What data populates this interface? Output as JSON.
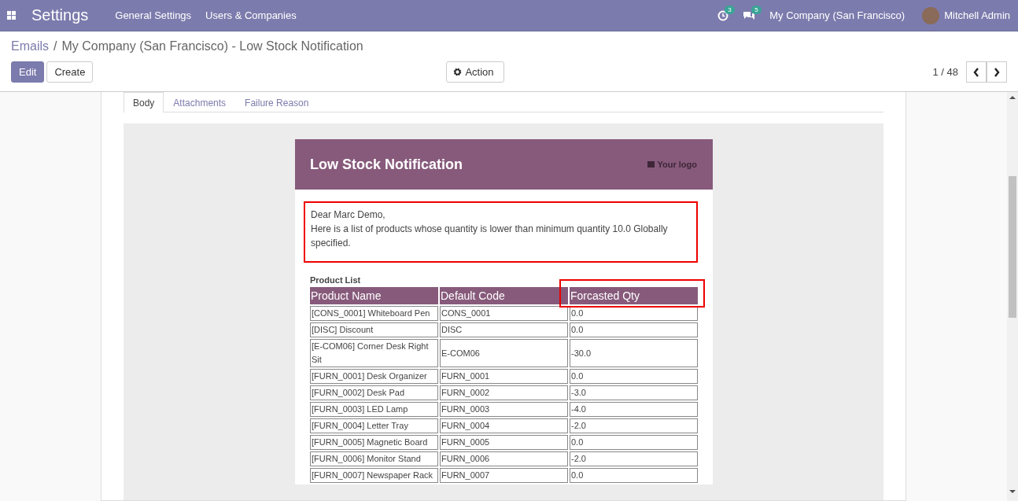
{
  "navbar": {
    "app_title": "Settings",
    "menu": [
      "General Settings",
      "Users & Companies"
    ],
    "activity_count": "3",
    "message_count": "5",
    "company": "My Company (San Francisco)",
    "user": "Mitchell Admin"
  },
  "breadcrumb": {
    "parent": "Emails",
    "separator": "/",
    "current": "My Company (San Francisco) - Low Stock Notification"
  },
  "buttons": [
    {
      "label": "Edit",
      "kind": "primary"
    },
    {
      "label": "Create",
      "kind": "secondary"
    }
  ],
  "action_button": "Action",
  "pager": {
    "value": "1 / 48"
  },
  "tabs": [
    {
      "label": "Body",
      "selected": true
    },
    {
      "label": "Attachments",
      "selected": false
    },
    {
      "label": "Failure Reason",
      "selected": false
    }
  ],
  "email": {
    "title": "Low Stock Notification",
    "logo_text": "Your logo",
    "greeting": "Dear Marc Demo,",
    "message": "Here is a list of products whose quantity is lower than minimum quantity 10.0 Globally specified.",
    "greeting_highlighted": true,
    "table": {
      "caption": "Product List",
      "columns": [
        {
          "label": "Product Name",
          "highlighted": false
        },
        {
          "label": "Default Code",
          "highlighted": false
        },
        {
          "label": "Forcasted Qty",
          "highlighted": true
        }
      ],
      "rows": [
        [
          "[CONS_0001] Whiteboard Pen",
          "CONS_0001",
          "0.0"
        ],
        [
          "[DISC] Discount",
          "DISC",
          "0.0"
        ],
        [
          "[E-COM06] Corner Desk Right Sit",
          "E-COM06",
          "-30.0"
        ],
        [
          "[FURN_0001] Desk Organizer",
          "FURN_0001",
          "0.0"
        ],
        [
          "[FURN_0002] Desk Pad",
          "FURN_0002",
          "-3.0"
        ],
        [
          "[FURN_0003] LED Lamp",
          "FURN_0003",
          "-4.0"
        ],
        [
          "[FURN_0004] Letter Tray",
          "FURN_0004",
          "-2.0"
        ],
        [
          "[FURN_0005] Magnetic Board",
          "FURN_0005",
          "0.0"
        ],
        [
          "[FURN_0006] Monitor Stand",
          "FURN_0006",
          "-2.0"
        ],
        [
          "[FURN_0007] Newspaper Rack",
          "FURN_0007",
          "0.0"
        ]
      ]
    }
  }
}
